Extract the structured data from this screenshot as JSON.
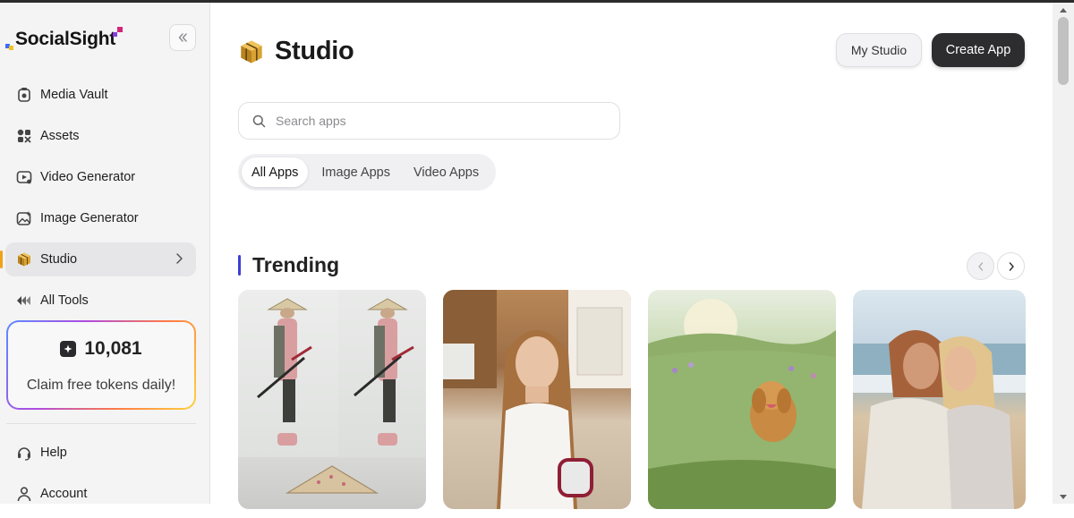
{
  "brand": {
    "name": "SocialSight"
  },
  "sidebar": {
    "collapse_icon": "chevrons-left-icon",
    "items": [
      {
        "label": "Media Vault",
        "icon": "media-vault-icon"
      },
      {
        "label": "Assets",
        "icon": "assets-icon"
      },
      {
        "label": "Video Generator",
        "icon": "video-generator-icon"
      },
      {
        "label": "Image Generator",
        "icon": "image-generator-icon"
      },
      {
        "label": "Studio",
        "icon": "studio-cube-icon",
        "active": true
      },
      {
        "label": "All Tools",
        "icon": "all-tools-icon"
      }
    ],
    "tokens": {
      "count": "10,081",
      "claim_text": "Claim free tokens daily!"
    },
    "bottom_items": [
      {
        "label": "Help",
        "icon": "headset-icon"
      },
      {
        "label": "Account",
        "icon": "user-icon"
      }
    ]
  },
  "main": {
    "title": "Studio",
    "my_studio_label": "My Studio",
    "create_app_label": "Create App",
    "search": {
      "placeholder": "Search apps",
      "value": ""
    },
    "tabs": [
      {
        "label": "All Apps",
        "active": true
      },
      {
        "label": "Image Apps",
        "active": false
      },
      {
        "label": "Video Apps",
        "active": false
      }
    ],
    "section_title": "Trending",
    "cards": [
      {
        "name": "card-samurai-grid"
      },
      {
        "name": "card-woman-kitchen"
      },
      {
        "name": "card-dog-meadow"
      },
      {
        "name": "card-couple-beach"
      }
    ]
  },
  "colors": {
    "accent_bar": "#3b3fd1",
    "create_button": "#2d2d30",
    "active_marker": "#f1a21a"
  }
}
